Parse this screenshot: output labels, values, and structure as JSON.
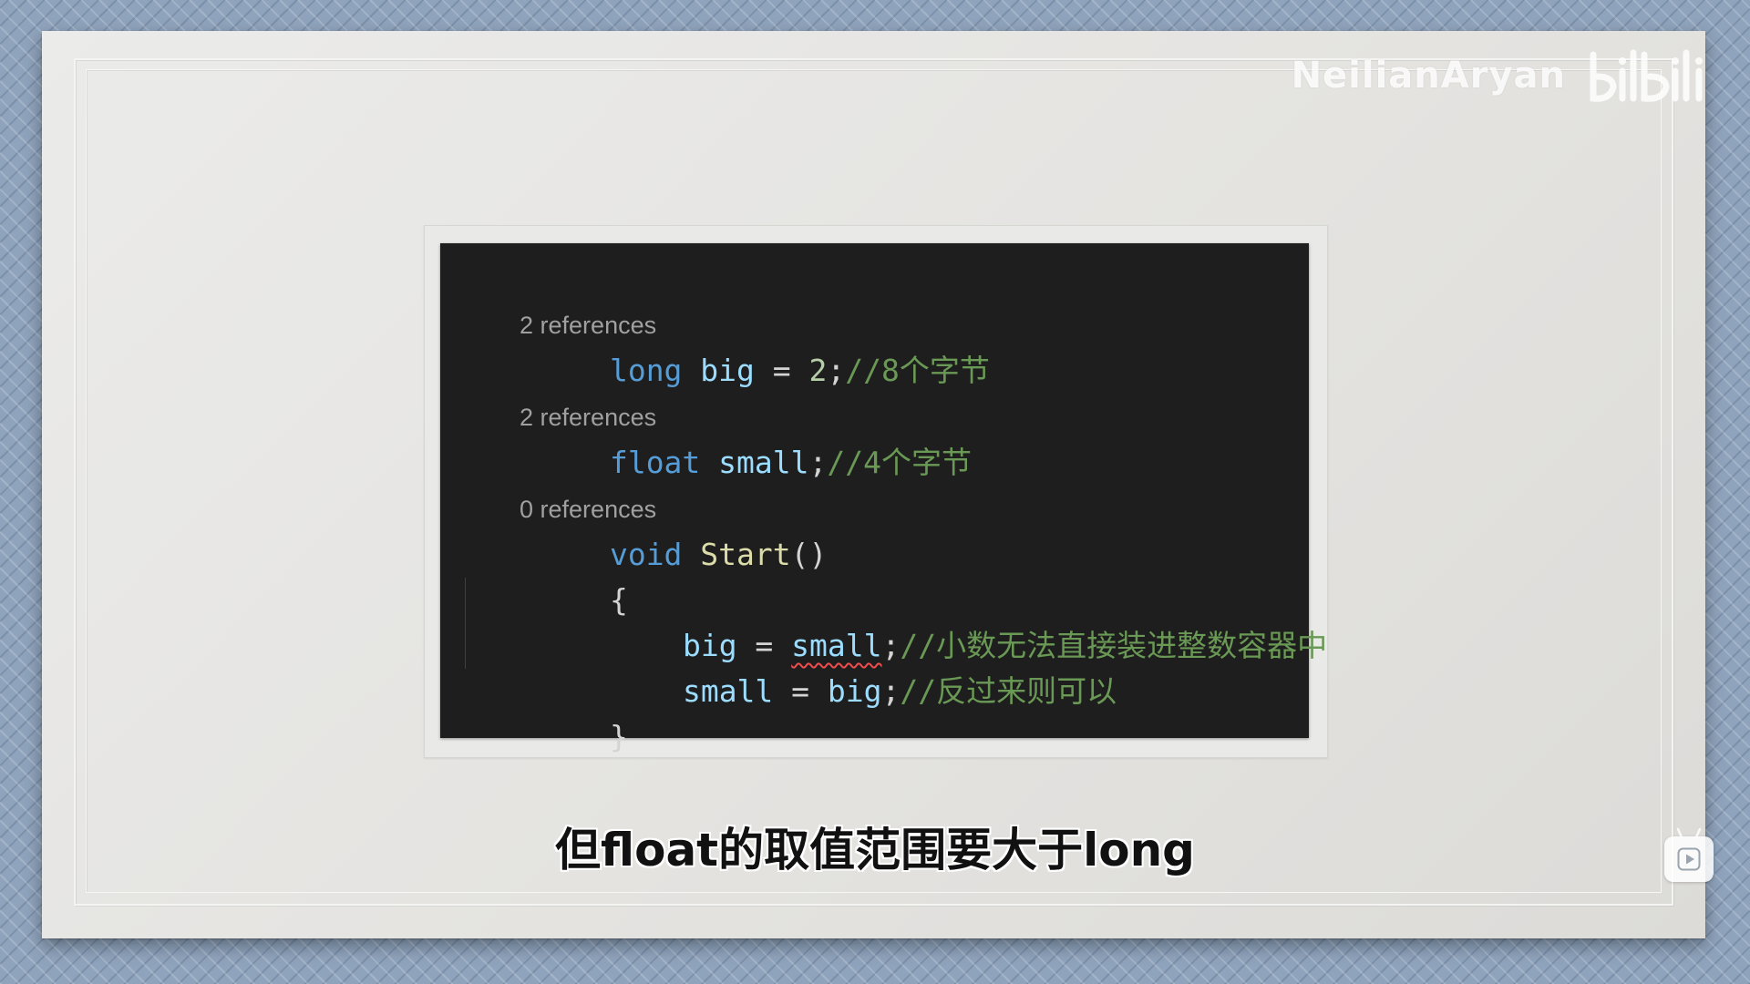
{
  "watermark": {
    "channel_name": "NeilianAryan",
    "logo_icon": "bilibili-logo-icon"
  },
  "code_editor": {
    "lines": [
      {
        "type": "codelens",
        "text": "2 references"
      },
      {
        "type": "code",
        "tokens": {
          "t1": "long",
          "t2": " big",
          "t3": " = ",
          "t4": "2",
          "t5": ";",
          "t6": "//8个字节"
        }
      },
      {
        "type": "codelens",
        "text": "2 references"
      },
      {
        "type": "code",
        "tokens": {
          "t1": "float",
          "t2": " small",
          "t3": ";",
          "t4": "//4个字节"
        }
      },
      {
        "type": "codelens",
        "text": "0 references"
      },
      {
        "type": "code",
        "tokens": {
          "t1": "void",
          "t2": " Start",
          "t3": "()"
        }
      },
      {
        "type": "code",
        "tokens": {
          "t1": "{"
        }
      },
      {
        "type": "code",
        "tokens": {
          "t1": "big",
          "t2": " = ",
          "t3": "small",
          "t4": ";",
          "t5": "//小数无法直接装进整数容器中"
        }
      },
      {
        "type": "code",
        "tokens": {
          "t1": "small",
          "t2": " = ",
          "t3": "big",
          "t4": ";",
          "t5": "//反过来则可以"
        }
      },
      {
        "type": "code",
        "tokens": {
          "t1": "}"
        }
      }
    ],
    "error_token": "small",
    "colors": {
      "background": "#1e1e1e",
      "keyword": "#569cd6",
      "identifier": "#9cdcfe",
      "function": "#dcdcaa",
      "number": "#b5cea8",
      "comment": "#6a9955",
      "codelens": "#a0a0a0",
      "error_squiggle": "#f14c4c"
    }
  },
  "subtitle": {
    "text": "但float的取值范围要大于long"
  },
  "play_badge": {
    "icon": "play-icon"
  }
}
